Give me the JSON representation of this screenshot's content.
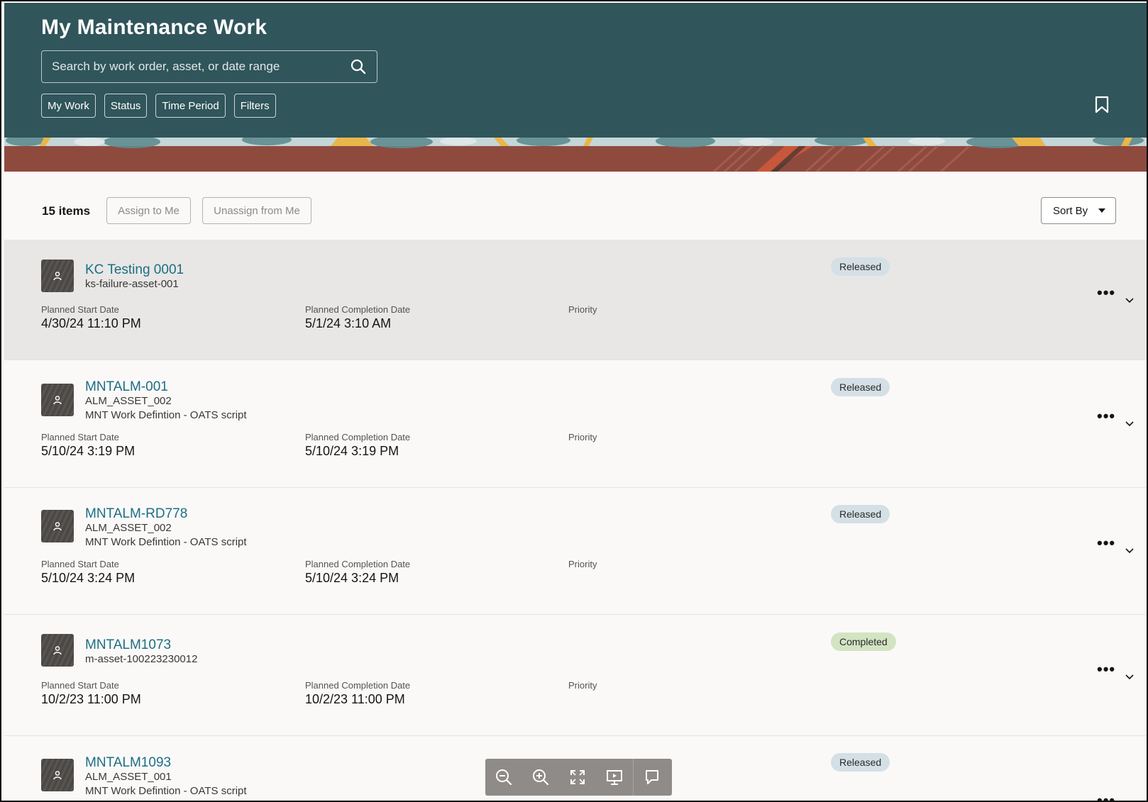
{
  "header": {
    "title": "My Maintenance Work",
    "search_placeholder": "Search by work order, asset, or date range",
    "chips": [
      "My Work",
      "Status",
      "Time Period",
      "Filters"
    ]
  },
  "toolbar": {
    "count": "15 items",
    "assign_label": "Assign to Me",
    "unassign_label": "Unassign from Me",
    "sort_label": "Sort By"
  },
  "labels": {
    "planned_start": "Planned Start Date",
    "planned_completion": "Planned Completion Date",
    "priority": "Priority"
  },
  "colors": {
    "header_bg": "#30555a",
    "link": "#1c6e84",
    "released_badge": "#d4e0e6",
    "completed_badge": "#d3e4c3",
    "selected_row": "#e8e7e5"
  },
  "work_orders": [
    {
      "title": "KC Testing 0001",
      "asset": "ks-failure-asset-001",
      "description": "",
      "planned_start": "4/30/24 11:10 PM",
      "planned_completion": "5/1/24 3:10 AM",
      "priority": "",
      "status": "Released"
    },
    {
      "title": "MNTALM-001",
      "asset": "ALM_ASSET_002",
      "description": "MNT Work Defintion - OATS script",
      "planned_start": "5/10/24 3:19 PM",
      "planned_completion": "5/10/24 3:19 PM",
      "priority": "",
      "status": "Released"
    },
    {
      "title": "MNTALM-RD778",
      "asset": "ALM_ASSET_002",
      "description": "MNT Work Defintion - OATS script",
      "planned_start": "5/10/24 3:24 PM",
      "planned_completion": "5/10/24 3:24 PM",
      "priority": "",
      "status": "Released"
    },
    {
      "title": "MNTALM1073",
      "asset": "m-asset-100223230012",
      "description": "",
      "planned_start": "10/2/23 11:00 PM",
      "planned_completion": "10/2/23 11:00 PM",
      "priority": "",
      "status": "Completed"
    },
    {
      "title": "MNTALM1093",
      "asset": "ALM_ASSET_001",
      "description": "MNT Work Defintion - OATS script",
      "status": "Released"
    }
  ],
  "viewer_toolbar": {
    "icons": [
      "zoom-out-icon",
      "zoom-in-icon",
      "fullscreen-icon",
      "presentation-icon",
      "comment-icon"
    ]
  }
}
